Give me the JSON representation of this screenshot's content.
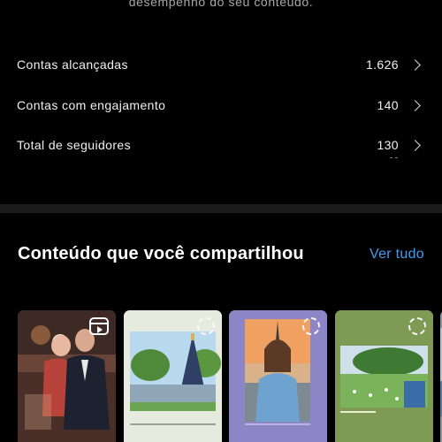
{
  "header": {
    "subtitle": "desempenho do seu conteúdo."
  },
  "stats": [
    {
      "label": "Contas alcançadas",
      "value": "1.626"
    },
    {
      "label": "Contas com engajamento",
      "value": "140"
    },
    {
      "label": "Total de seguidores",
      "value": "130"
    }
  ],
  "shared_content": {
    "title": "Conteúdo que você compartilhou",
    "see_all": "Ver tudo",
    "items": [
      {
        "kind": "reel",
        "icon": "reels-icon"
      },
      {
        "kind": "story",
        "icon": "loading-icon"
      },
      {
        "kind": "story",
        "icon": "loading-icon"
      },
      {
        "kind": "story",
        "icon": "loading-icon"
      },
      {
        "kind": "story"
      }
    ]
  },
  "colors": {
    "background": "#000000",
    "link": "#3f9cf2",
    "divider": "#1c1c1c"
  }
}
